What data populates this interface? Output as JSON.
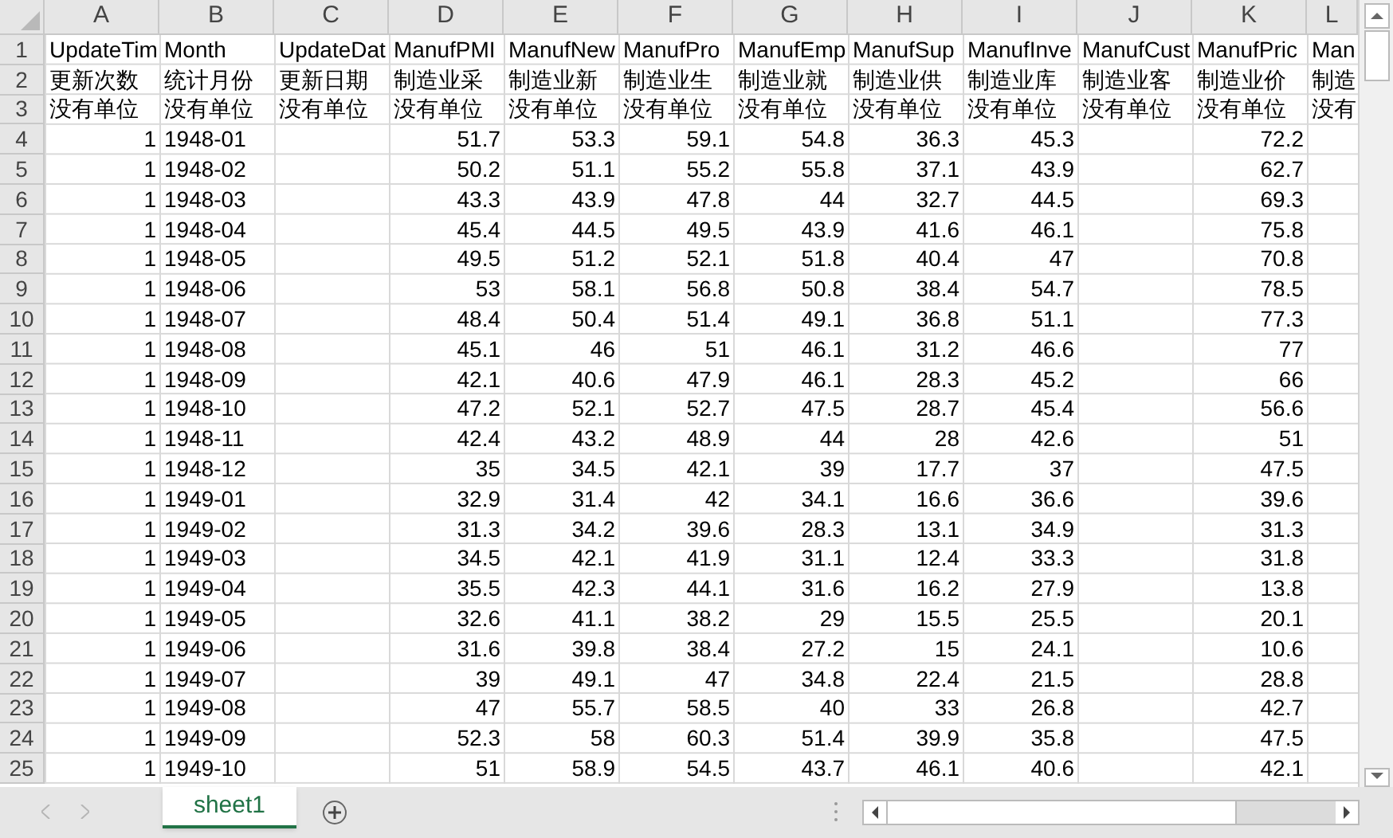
{
  "columns": [
    "A",
    "B",
    "C",
    "D",
    "E",
    "F",
    "G",
    "H",
    "I",
    "J",
    "K",
    "L"
  ],
  "header_rows": [
    {
      "row": "1",
      "cells": [
        "UpdateTim",
        "Month",
        "UpdateDat",
        "ManufPMI",
        "ManufNew",
        "ManufPro",
        "ManufEmp",
        "ManufSup",
        "ManufInve",
        "ManufCust",
        "ManufPric",
        "Man"
      ]
    },
    {
      "row": "2",
      "cells": [
        "更新次数",
        "统计月份",
        "更新日期",
        "制造业采",
        "制造业新",
        "制造业生",
        "制造业就",
        "制造业供",
        "制造业库",
        "制造业客",
        "制造业价",
        "制造"
      ]
    },
    {
      "row": "3",
      "cells": [
        "没有单位",
        "没有单位",
        "没有单位",
        "没有单位",
        "没有单位",
        "没有单位",
        "没有单位",
        "没有单位",
        "没有单位",
        "没有单位",
        "没有单位",
        "没有"
      ]
    }
  ],
  "data_rows": [
    {
      "row": "4",
      "month": "1948-01",
      "cells": {
        "A": "1",
        "D": "51.7",
        "E": "53.3",
        "F": "59.1",
        "G": "54.8",
        "H": "36.3",
        "I": "45.3",
        "K": "72.2"
      }
    },
    {
      "row": "5",
      "month": "1948-02",
      "cells": {
        "A": "1",
        "D": "50.2",
        "E": "51.1",
        "F": "55.2",
        "G": "55.8",
        "H": "37.1",
        "I": "43.9",
        "K": "62.7"
      }
    },
    {
      "row": "6",
      "month": "1948-03",
      "cells": {
        "A": "1",
        "D": "43.3",
        "E": "43.9",
        "F": "47.8",
        "G": "44",
        "H": "32.7",
        "I": "44.5",
        "K": "69.3"
      }
    },
    {
      "row": "7",
      "month": "1948-04",
      "cells": {
        "A": "1",
        "D": "45.4",
        "E": "44.5",
        "F": "49.5",
        "G": "43.9",
        "H": "41.6",
        "I": "46.1",
        "K": "75.8"
      }
    },
    {
      "row": "8",
      "month": "1948-05",
      "cells": {
        "A": "1",
        "D": "49.5",
        "E": "51.2",
        "F": "52.1",
        "G": "51.8",
        "H": "40.4",
        "I": "47",
        "K": "70.8"
      }
    },
    {
      "row": "9",
      "month": "1948-06",
      "cells": {
        "A": "1",
        "D": "53",
        "E": "58.1",
        "F": "56.8",
        "G": "50.8",
        "H": "38.4",
        "I": "54.7",
        "K": "78.5"
      }
    },
    {
      "row": "10",
      "month": "1948-07",
      "cells": {
        "A": "1",
        "D": "48.4",
        "E": "50.4",
        "F": "51.4",
        "G": "49.1",
        "H": "36.8",
        "I": "51.1",
        "K": "77.3"
      }
    },
    {
      "row": "11",
      "month": "1948-08",
      "cells": {
        "A": "1",
        "D": "45.1",
        "E": "46",
        "F": "51",
        "G": "46.1",
        "H": "31.2",
        "I": "46.6",
        "K": "77"
      }
    },
    {
      "row": "12",
      "month": "1948-09",
      "cells": {
        "A": "1",
        "D": "42.1",
        "E": "40.6",
        "F": "47.9",
        "G": "46.1",
        "H": "28.3",
        "I": "45.2",
        "K": "66"
      }
    },
    {
      "row": "13",
      "month": "1948-10",
      "cells": {
        "A": "1",
        "D": "47.2",
        "E": "52.1",
        "F": "52.7",
        "G": "47.5",
        "H": "28.7",
        "I": "45.4",
        "K": "56.6"
      }
    },
    {
      "row": "14",
      "month": "1948-11",
      "cells": {
        "A": "1",
        "D": "42.4",
        "E": "43.2",
        "F": "48.9",
        "G": "44",
        "H": "28",
        "I": "42.6",
        "K": "51"
      }
    },
    {
      "row": "15",
      "month": "1948-12",
      "cells": {
        "A": "1",
        "D": "35",
        "E": "34.5",
        "F": "42.1",
        "G": "39",
        "H": "17.7",
        "I": "37",
        "K": "47.5"
      }
    },
    {
      "row": "16",
      "month": "1949-01",
      "cells": {
        "A": "1",
        "D": "32.9",
        "E": "31.4",
        "F": "42",
        "G": "34.1",
        "H": "16.6",
        "I": "36.6",
        "K": "39.6"
      }
    },
    {
      "row": "17",
      "month": "1949-02",
      "cells": {
        "A": "1",
        "D": "31.3",
        "E": "34.2",
        "F": "39.6",
        "G": "28.3",
        "H": "13.1",
        "I": "34.9",
        "K": "31.3"
      }
    },
    {
      "row": "18",
      "month": "1949-03",
      "cells": {
        "A": "1",
        "D": "34.5",
        "E": "42.1",
        "F": "41.9",
        "G": "31.1",
        "H": "12.4",
        "I": "33.3",
        "K": "31.8"
      }
    },
    {
      "row": "19",
      "month": "1949-04",
      "cells": {
        "A": "1",
        "D": "35.5",
        "E": "42.3",
        "F": "44.1",
        "G": "31.6",
        "H": "16.2",
        "I": "27.9",
        "K": "13.8"
      }
    },
    {
      "row": "20",
      "month": "1949-05",
      "cells": {
        "A": "1",
        "D": "32.6",
        "E": "41.1",
        "F": "38.2",
        "G": "29",
        "H": "15.5",
        "I": "25.5",
        "K": "20.1"
      }
    },
    {
      "row": "21",
      "month": "1949-06",
      "cells": {
        "A": "1",
        "D": "31.6",
        "E": "39.8",
        "F": "38.4",
        "G": "27.2",
        "H": "15",
        "I": "24.1",
        "K": "10.6"
      }
    },
    {
      "row": "22",
      "month": "1949-07",
      "cells": {
        "A": "1",
        "D": "39",
        "E": "49.1",
        "F": "47",
        "G": "34.8",
        "H": "22.4",
        "I": "21.5",
        "K": "28.8"
      }
    },
    {
      "row": "23",
      "month": "1949-08",
      "cells": {
        "A": "1",
        "D": "47",
        "E": "55.7",
        "F": "58.5",
        "G": "40",
        "H": "33",
        "I": "26.8",
        "K": "42.7"
      }
    },
    {
      "row": "24",
      "month": "1949-09",
      "cells": {
        "A": "1",
        "D": "52.3",
        "E": "58",
        "F": "60.3",
        "G": "51.4",
        "H": "39.9",
        "I": "35.8",
        "K": "47.5"
      }
    },
    {
      "row": "25",
      "month": "1949-10",
      "cells": {
        "A": "1",
        "D": "51",
        "E": "58.9",
        "F": "54.5",
        "G": "43.7",
        "H": "46.1",
        "I": "40.6",
        "K": "42.1"
      }
    }
  ],
  "sheet_tabs": [
    {
      "label": "sheet1",
      "selected": true
    }
  ]
}
